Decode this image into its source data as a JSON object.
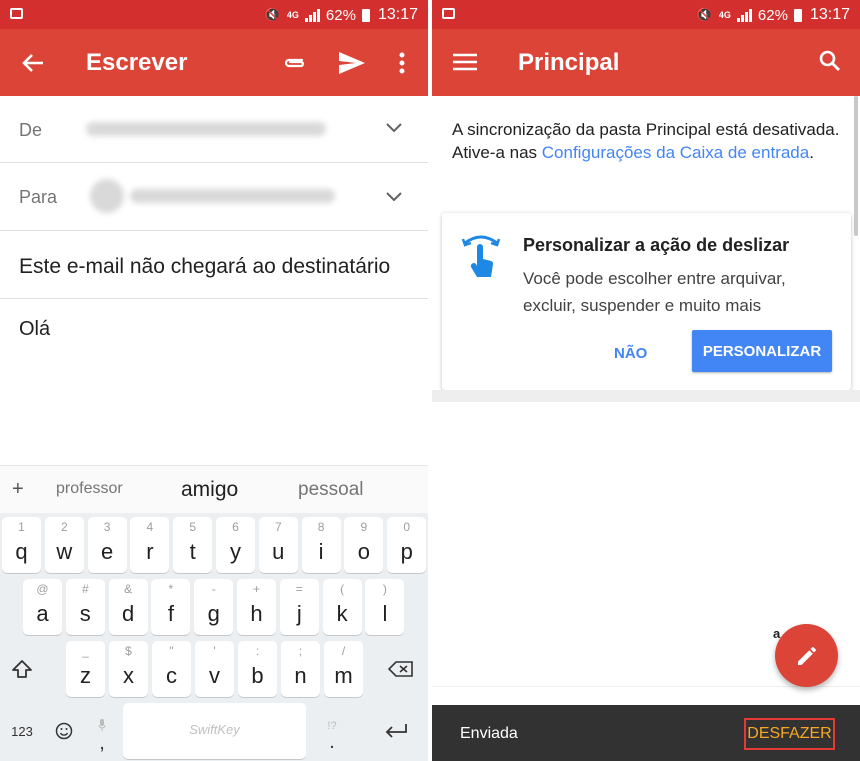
{
  "status_bar": {
    "battery": "62%",
    "time": "13:17",
    "network": "4G"
  },
  "compose": {
    "title": "Escrever",
    "from_label": "De",
    "to_label": "Para",
    "subject": "Este e-mail não chegará ao destinatário",
    "body": "Olá",
    "accent": "#db4437"
  },
  "keyboard": {
    "suggestion_plus": "+",
    "suggestions": [
      "professor",
      "amigo",
      "pessoal"
    ],
    "row1": [
      {
        "hint": "1",
        "key": "q"
      },
      {
        "hint": "2",
        "key": "w"
      },
      {
        "hint": "3",
        "key": "e"
      },
      {
        "hint": "4",
        "key": "r"
      },
      {
        "hint": "5",
        "key": "t"
      },
      {
        "hint": "6",
        "key": "y"
      },
      {
        "hint": "7",
        "key": "u"
      },
      {
        "hint": "8",
        "key": "i"
      },
      {
        "hint": "9",
        "key": "o"
      },
      {
        "hint": "0",
        "key": "p"
      }
    ],
    "row2": [
      {
        "hint": "@",
        "key": "a"
      },
      {
        "hint": "#",
        "key": "s"
      },
      {
        "hint": "&",
        "key": "d"
      },
      {
        "hint": "*",
        "key": "f"
      },
      {
        "hint": "-",
        "key": "g"
      },
      {
        "hint": "+",
        "key": "h"
      },
      {
        "hint": "=",
        "key": "j"
      },
      {
        "hint": "(",
        "key": "k"
      },
      {
        "hint": ")",
        "key": "l"
      }
    ],
    "row3": [
      {
        "hint": "_",
        "key": "z"
      },
      {
        "hint": "$",
        "key": "x"
      },
      {
        "hint": "\"",
        "key": "c"
      },
      {
        "hint": "'",
        "key": "v"
      },
      {
        "hint": ":",
        "key": "b"
      },
      {
        "hint": ";",
        "key": "n"
      },
      {
        "hint": "/",
        "key": "m"
      }
    ],
    "numbers_key": "123",
    "comma_key": ",",
    "comma_hint": "🎤",
    "space_label": "SwiftKey",
    "period_key": ".",
    "period_hint": "!?"
  },
  "inbox": {
    "title": "Principal",
    "sync_text": "A sincronização da pasta Principal está desativada. Ative-a nas ",
    "sync_link": "Configurações da Caixa de entrada",
    "sync_end": ".",
    "card_title": "Personalizar a ação de deslizar",
    "card_desc": "Você pode escolher entre arquivar, excluir, suspender e muito mais",
    "card_no": "NÃO",
    "card_yes": "PERSONALIZAR",
    "partial_text": "a",
    "snackbar_text": "Enviada",
    "snackbar_action": "DESFAZER",
    "link_color": "#4285f4"
  }
}
